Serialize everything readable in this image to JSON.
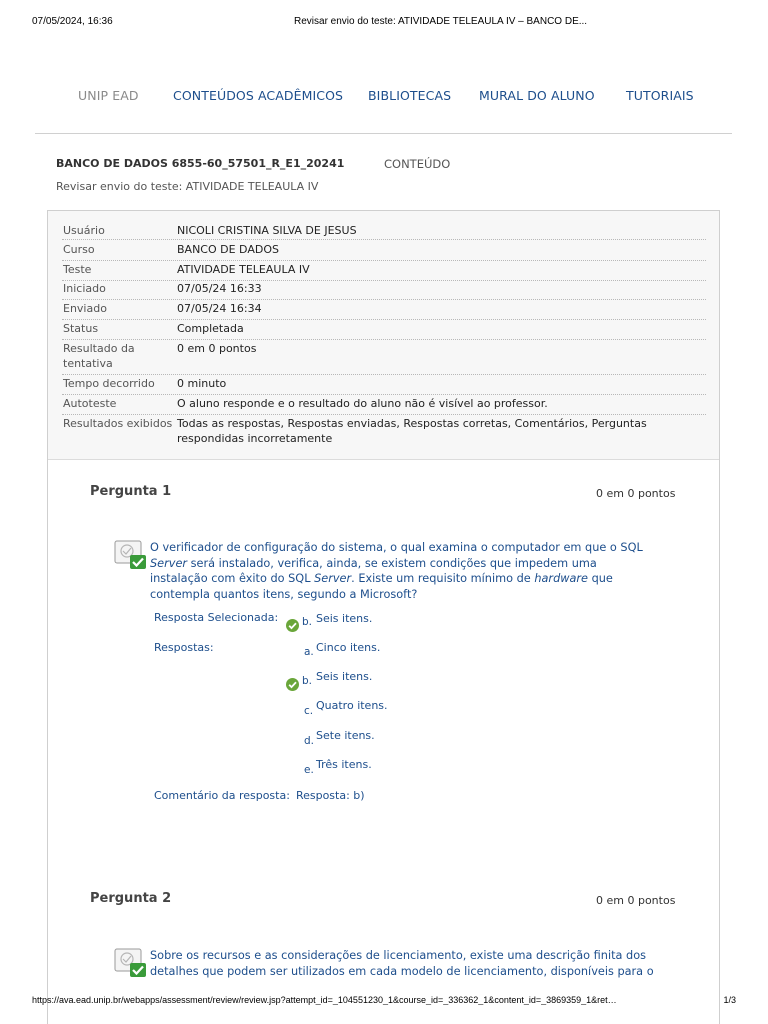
{
  "print_header": {
    "date": "07/05/2024, 16:36",
    "title": "Revisar envio do teste: ATIVIDADE TELEAULA IV – BANCO DE..."
  },
  "nav": {
    "brand": "UNIP EAD",
    "items": [
      "CONTEÚDOS ACADÊMICOS",
      "BIBLIOTECAS",
      "MURAL DO ALUNO",
      "TUTORIAIS"
    ]
  },
  "breadcrumb": {
    "course": "BANCO DE DADOS 6855-60_57501_R_E1_20241",
    "section": "CONTEÚDO"
  },
  "page_subtitle": "Revisar envio do teste: ATIVIDADE TELEAULA IV",
  "summary": [
    {
      "label": "Usuário",
      "value": "NICOLI CRISTINA SILVA DE JESUS"
    },
    {
      "label": "Curso",
      "value": "BANCO DE DADOS"
    },
    {
      "label": "Teste",
      "value": "ATIVIDADE TELEAULA IV"
    },
    {
      "label": "Iniciado",
      "value": "07/05/24 16:33"
    },
    {
      "label": "Enviado",
      "value": "07/05/24 16:34"
    },
    {
      "label": "Status",
      "value": "Completada"
    },
    {
      "label": "Resultado da tentativa",
      "value": "0 em 0 pontos"
    },
    {
      "label": "Tempo decorrido",
      "value": "0 minuto"
    },
    {
      "label": "Autoteste",
      "value": "O aluno responde e o resultado do aluno não é visível ao professor."
    },
    {
      "label": "Resultados exibidos",
      "value": "Todas as respostas, Respostas enviadas, Respostas corretas, Comentários, Perguntas respondidas incorretamente"
    }
  ],
  "questions": [
    {
      "title": "Pergunta 1",
      "score": "0 em 0 pontos",
      "text_parts": [
        "O verificador de configuração do sistema, o qual examina o computador em que o SQL ",
        "Server",
        " será instalado, verifica, ainda, se existem condições que impedem uma instalação com êxito do SQL ",
        "Server",
        ". Existe um requisito mínimo de ",
        "hardware",
        " que contempla quantos itens, segundo a Microsoft?"
      ],
      "selected_label": "Resposta Selecionada:",
      "selected": {
        "letter": "b.",
        "text": "Seis itens."
      },
      "answers_label": "Respostas:",
      "answers": [
        {
          "letter": "a.",
          "text": "Cinco itens.",
          "correct": false
        },
        {
          "letter": "b.",
          "text": "Seis itens.",
          "correct": true
        },
        {
          "letter": "c.",
          "text": "Quatro itens.",
          "correct": false
        },
        {
          "letter": "d.",
          "text": "Sete itens.",
          "correct": false
        },
        {
          "letter": "e.",
          "text": "Três itens.",
          "correct": false
        }
      ],
      "comment_label": "Comentário da resposta:",
      "comment": "Resposta: b)"
    },
    {
      "title": "Pergunta 2",
      "score": "0 em 0 pontos",
      "text": "Sobre os recursos e as considerações de licenciamento, existe uma descrição finita dos detalhes que podem ser utilizados em cada modelo de licenciamento, disponíveis para o"
    }
  ],
  "print_footer": {
    "url": "https://ava.ead.unip.br/webapps/assessment/review/review.jsp?attempt_id=_104551230_1&course_id=_336362_1&content_id=_3869359_1&ret…",
    "page": "1/3"
  },
  "colors": {
    "link_blue": "#1d4e8c",
    "brand_gray": "#8a8a8a",
    "correct_green": "#6aa63a"
  },
  "icons": [
    "question-correct-icon",
    "check-icon"
  ]
}
